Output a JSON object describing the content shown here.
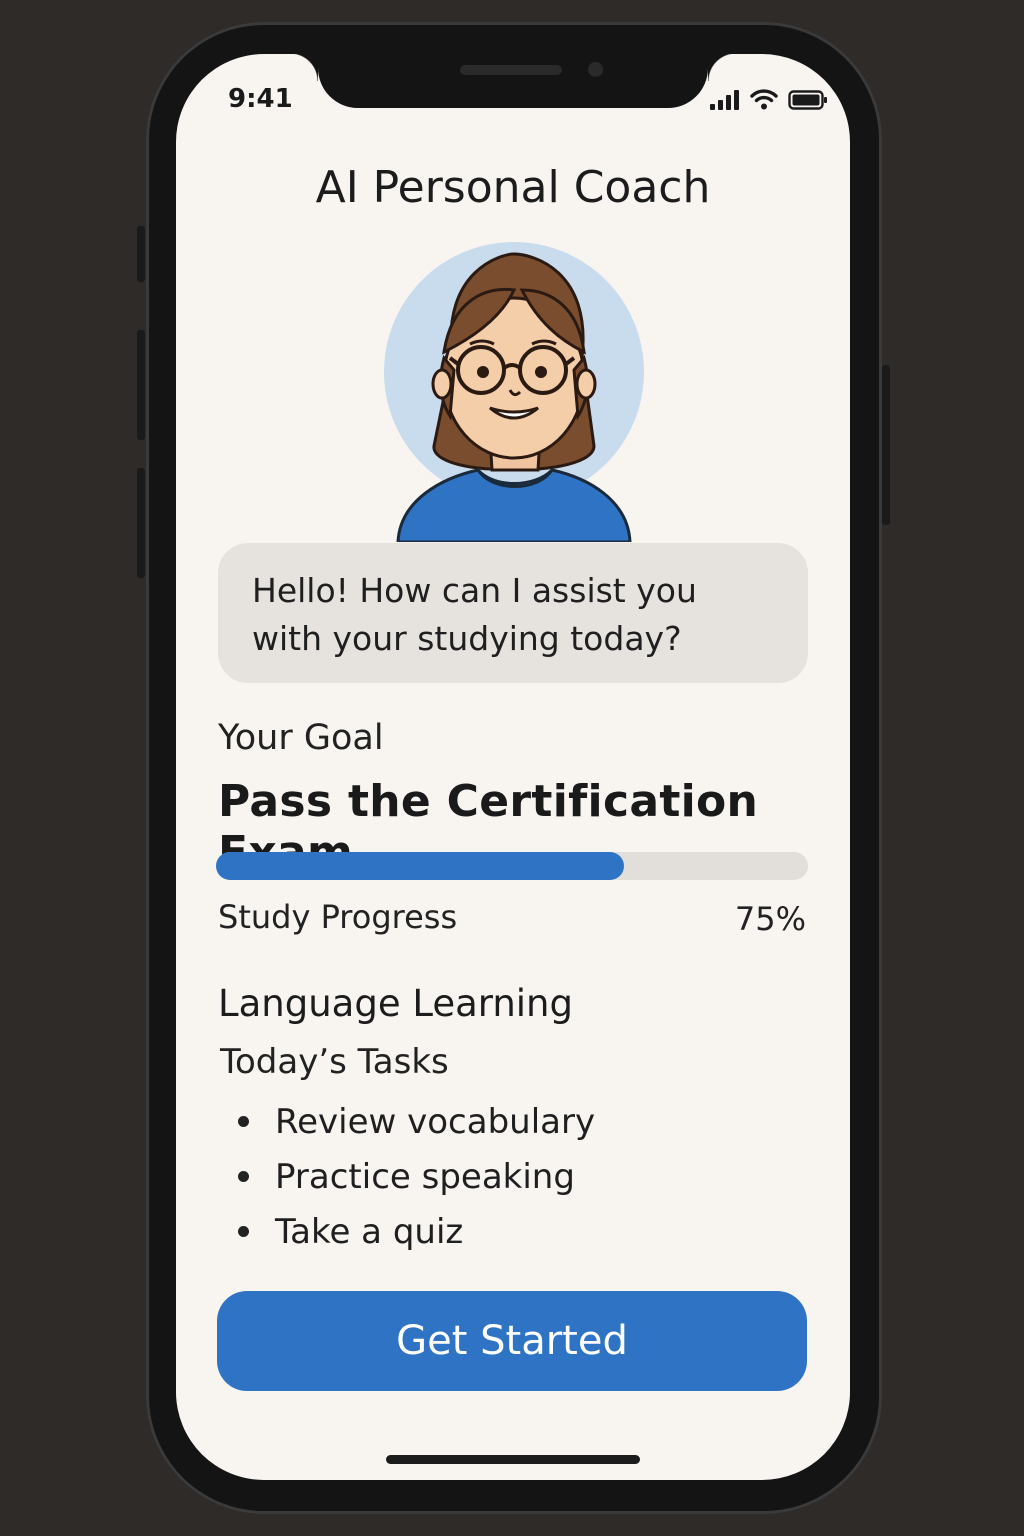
{
  "status_bar": {
    "time": "9:41"
  },
  "header": {
    "title": "AI Personal Coach"
  },
  "coach": {
    "message": "Hello! How can I assist you with your studying today?"
  },
  "goal": {
    "label": "Your Goal",
    "title": "Pass the Certification Exam"
  },
  "progress": {
    "label": "Study Progress",
    "value_text": "75%",
    "value": 0.75
  },
  "section": {
    "title": "Language Learning",
    "tasks_label": "Today’s Tasks",
    "tasks": [
      "Review vocabulary",
      "Practice speaking",
      "Take a quiz"
    ]
  },
  "cta": {
    "label": "Get Started"
  },
  "colors": {
    "accent": "#2f74c4",
    "background": "#f8f5f1",
    "bubble": "#e6e2de",
    "avatar_circle": "#c9dcee"
  },
  "icons": [
    "signal-icon",
    "wifi-icon",
    "battery-icon",
    "coach-avatar"
  ]
}
